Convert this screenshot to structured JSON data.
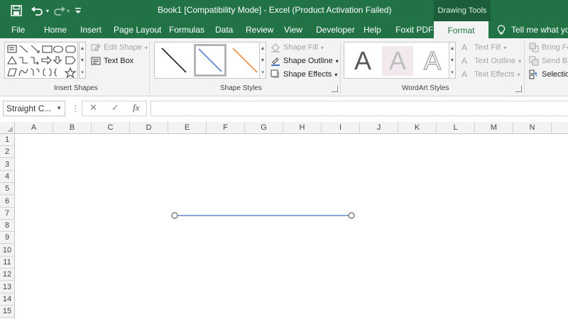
{
  "window": {
    "title": "Book1  [Compatibility Mode]  -  Excel (Product Activation Failed)",
    "contextual_group": "Drawing Tools",
    "qat_icons": [
      "save-icon",
      "undo-icon",
      "redo-icon",
      "customize-qat-icon"
    ]
  },
  "tabs": [
    "File",
    "Home",
    "Insert",
    "Page Layout",
    "Formulas",
    "Data",
    "Review",
    "View",
    "Developer",
    "Help",
    "Foxit PDF",
    "Format"
  ],
  "active_tab": "Format",
  "tell_me": "Tell me what you",
  "ribbon": {
    "insert_shapes": {
      "label": "Insert Shapes",
      "edit_shape": "Edit Shape",
      "text_box": "Text Box"
    },
    "shape_styles": {
      "label": "Shape Styles",
      "swatch_colors": [
        "#000000",
        "#4472c4",
        "#ed7d31"
      ],
      "shape_fill": "Shape Fill",
      "shape_outline": "Shape Outline",
      "shape_effects": "Shape Effects"
    },
    "wordart_styles": {
      "label": "WordArt Styles",
      "letters": [
        "A",
        "A",
        "A"
      ],
      "text_fill": "Text Fill",
      "text_outline": "Text Outline",
      "text_effects": "Text Effects"
    },
    "arrange": {
      "bring_forward": "Bring For",
      "send_backward": "Send Bac",
      "selection_pane": "Selection"
    }
  },
  "formula_bar": {
    "name_box": "Straight C...",
    "function_label": "fx",
    "cancel_label": "✕",
    "enter_label": "✓",
    "value": ""
  },
  "grid": {
    "columns": [
      "A",
      "B",
      "C",
      "D",
      "E",
      "F",
      "G",
      "H",
      "I",
      "J",
      "K",
      "L",
      "M",
      "N"
    ],
    "rows": [
      "1",
      "2",
      "3",
      "4",
      "5",
      "6",
      "7",
      "8",
      "9",
      "10",
      "11",
      "12",
      "13",
      "14",
      "15"
    ]
  },
  "selected_shape": {
    "type": "Straight Connector",
    "color": "#4472c4"
  },
  "colors": {
    "excel_green": "#217346",
    "ribbon_bg": "#f3f3f3"
  }
}
